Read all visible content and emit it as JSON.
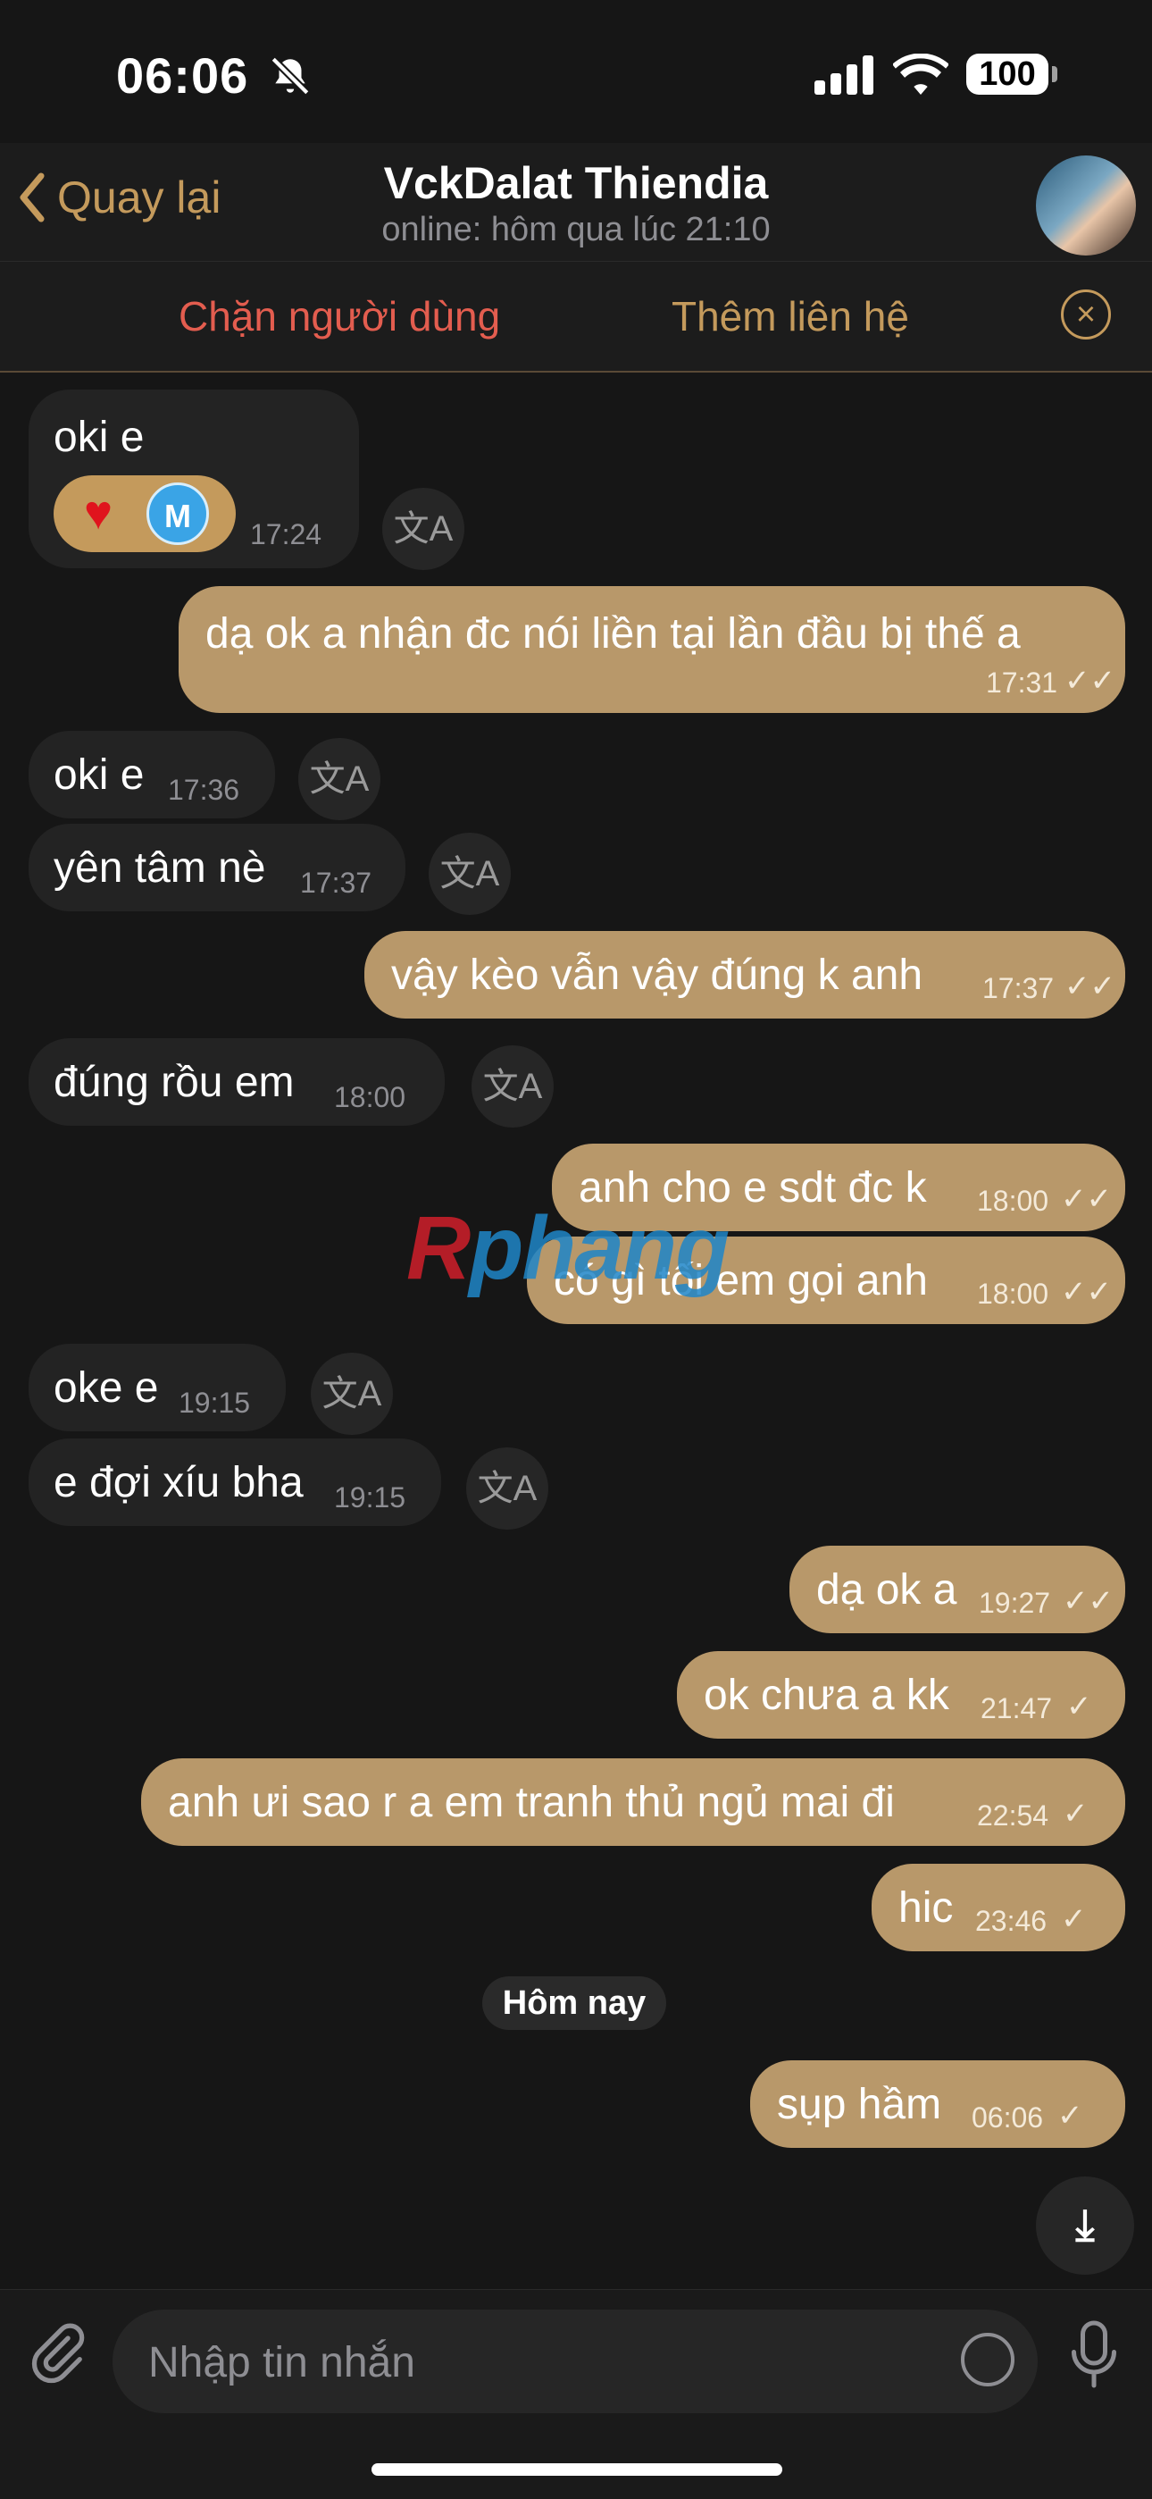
{
  "status": {
    "time": "06:06",
    "battery": "100"
  },
  "header": {
    "back_label": "Quay lại",
    "title": "VckDalat Thiendia",
    "subtitle": "online: hôm qua lúc 21:10"
  },
  "actions": {
    "block": "Chặn người dùng",
    "add_contact": "Thêm liên hệ"
  },
  "messages": [
    {
      "dir": "in",
      "text": "oki e",
      "time": "17:24",
      "reaction": [
        "heart",
        "M"
      ]
    },
    {
      "dir": "out",
      "text": "dạ ok a nhận đc nói liền tại lần đầu bị thế a",
      "time": "17:31",
      "read": true
    },
    {
      "dir": "in",
      "text": "oki e",
      "time": "17:36"
    },
    {
      "dir": "in",
      "text": "yên tâm nè",
      "time": "17:37"
    },
    {
      "dir": "out",
      "text": "vậy kèo vẫn vậy đúng k anh",
      "time": "17:37",
      "read": true
    },
    {
      "dir": "in",
      "text": "đúng rồu em",
      "time": "18:00"
    },
    {
      "dir": "out",
      "text": "anh cho e sdt đc k",
      "time": "18:00",
      "read": true
    },
    {
      "dir": "out",
      "text": "có gì tối em gọi anh",
      "time": "18:00",
      "read": true
    },
    {
      "dir": "in",
      "text": "oke e",
      "time": "19:15"
    },
    {
      "dir": "in",
      "text": "e đợi xíu bha",
      "time": "19:15"
    },
    {
      "dir": "out",
      "text": "dạ ok a",
      "time": "19:27",
      "read": true
    },
    {
      "dir": "out",
      "text": "ok chưa a kk",
      "time": "21:47",
      "read": false
    },
    {
      "dir": "out",
      "text": "anh ưi sao r a em tranh thủ ngủ mai đi",
      "time": "22:54",
      "read": false
    },
    {
      "dir": "out",
      "text": "hic",
      "time": "23:46",
      "read": false
    },
    {
      "dir": "out",
      "text": "sụp hầm",
      "time": "06:06",
      "read": false
    }
  ],
  "date_divider": "Hôm nay",
  "watermark": {
    "r": "R",
    "rest": "phang"
  },
  "input": {
    "placeholder": "Nhập tin nhắn"
  },
  "colors": {
    "accent": "#c49a5c",
    "outgoing_bubble": "#b8986a",
    "incoming_bubble": "#232323",
    "danger": "#e35d4f"
  },
  "icons": [
    "bell-slash-icon",
    "signal-icon",
    "wifi-icon",
    "chevron-left-icon",
    "close-circle-icon",
    "translate-icon",
    "paperclip-icon",
    "sticker-icon",
    "microphone-icon",
    "scroll-down-icon"
  ]
}
